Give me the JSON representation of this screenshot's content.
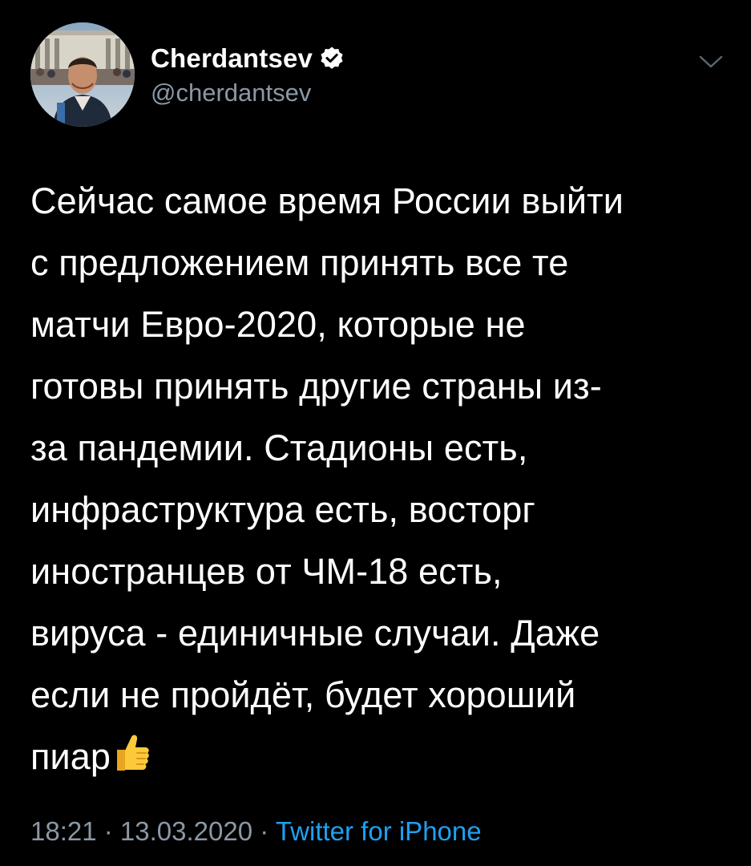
{
  "tweet": {
    "display_name": "Cherdantsev",
    "handle": "@cherdantsev",
    "verified": true,
    "text": "Сейчас самое время России выйти\nс предложением принять все те\nматчи Евро-2020, которые не\nготовы принять другие страны из-\nза пандемии. Стадионы есть,\nинфраструктура есть, восторг\nиностранцев от ЧМ-18 есть,\nвируса - единичные случаи. Даже\nесли не пройдёт, будет хороший\nпиар",
    "emoji": "thumbs-up",
    "time": "18:21",
    "separator_1": " · ",
    "date": "13.03.2020",
    "separator_2": " · ",
    "source": "Twitter for iPhone"
  },
  "icons": {
    "verified": "verified-badge-icon",
    "chevron": "chevron-down-icon",
    "emoji": "thumbs-up-icon"
  },
  "colors": {
    "background": "#000000",
    "text": "#ffffff",
    "secondary": "#8b98a5",
    "link": "#1da1f2"
  }
}
